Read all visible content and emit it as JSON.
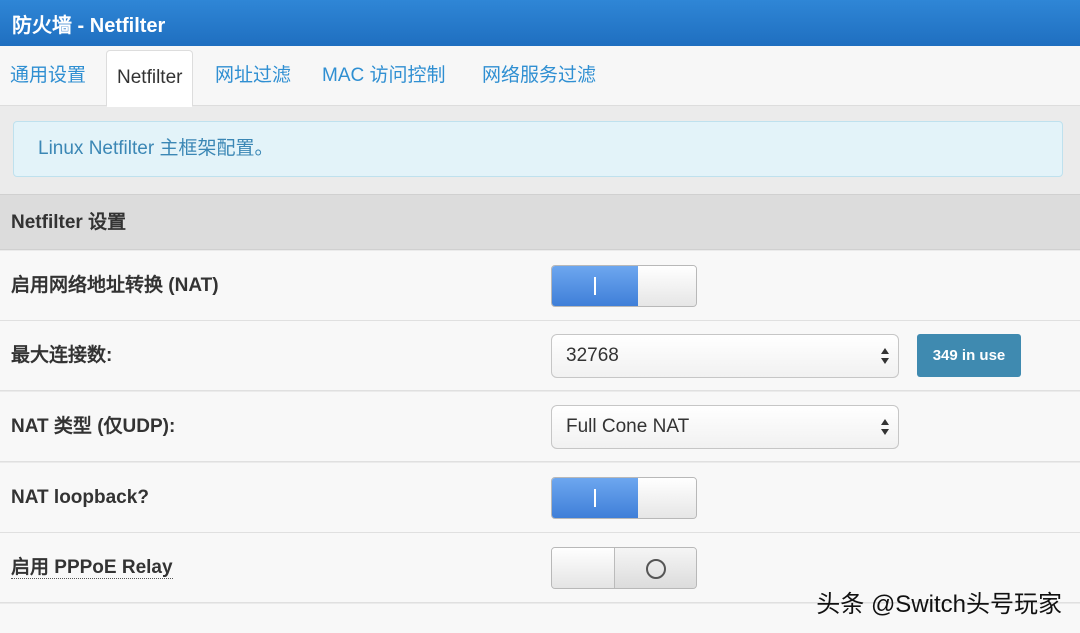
{
  "window": {
    "title": "防火墙 - Netfilter"
  },
  "tabs": [
    {
      "label": "通用设置"
    },
    {
      "label": "Netfilter"
    },
    {
      "label": "网址过滤"
    },
    {
      "label": "MAC 访问控制"
    },
    {
      "label": "网络服务过滤"
    }
  ],
  "active_tab": "Netfilter",
  "info": {
    "text": "Linux Netfilter 主框架配置。"
  },
  "section": {
    "title": "Netfilter 设置"
  },
  "settings": {
    "nat": {
      "label": "启用网络地址转换 (NAT)",
      "enabled": true
    },
    "max_conn": {
      "label": "最大连接数:",
      "value": "32768",
      "badge": "349 in use"
    },
    "nat_type": {
      "label": "NAT 类型 (仅UDP):",
      "value": "Full Cone NAT"
    },
    "loopback": {
      "label": "NAT loopback?",
      "enabled": true
    },
    "pppoe": {
      "label": "启用 PPPoE Relay",
      "enabled": false
    }
  },
  "colors": {
    "accent": "#2f86d6",
    "badge": "#3f8ab0",
    "toggle_on": "#4f8de0"
  },
  "watermark": "头条 @Switch头号玩家"
}
